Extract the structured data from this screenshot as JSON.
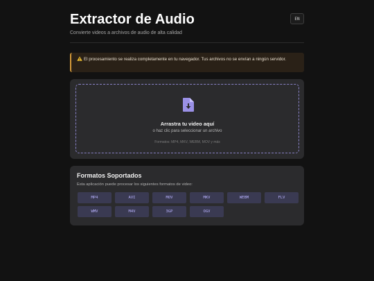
{
  "header": {
    "title": "Extractor de Audio",
    "subtitle": "Convierte videos a archivos de audio de alta calidad",
    "lang_button": "EN"
  },
  "notice": {
    "text": "El procesamiento se realiza completamente en tu navegador. Tus archivos no se envían a ningún servidor."
  },
  "dropzone": {
    "title": "Arrastra tu video aquí",
    "subtitle": "o haz clic para seleccionar un archivo",
    "formats": "Formatos: MP4, MKV, WEBM, MOV y más"
  },
  "formats_section": {
    "title": "Formatos Soportados",
    "description": "Esta aplicación puede procesar los siguientes formatos de video:",
    "formats": [
      "MP4",
      "AVI",
      "MOV",
      "MKV",
      "WEBM",
      "FLV",
      "WMV",
      "M4V",
      "3GP",
      "OGV"
    ]
  },
  "colors": {
    "background": "#121212",
    "card": "#2b2b2d",
    "accent": "#8a83c9",
    "chip": "#3a3a52",
    "warning": "#d49a3a"
  },
  "icons": {
    "notice": "warning-icon",
    "dropzone": "file-download-icon"
  }
}
